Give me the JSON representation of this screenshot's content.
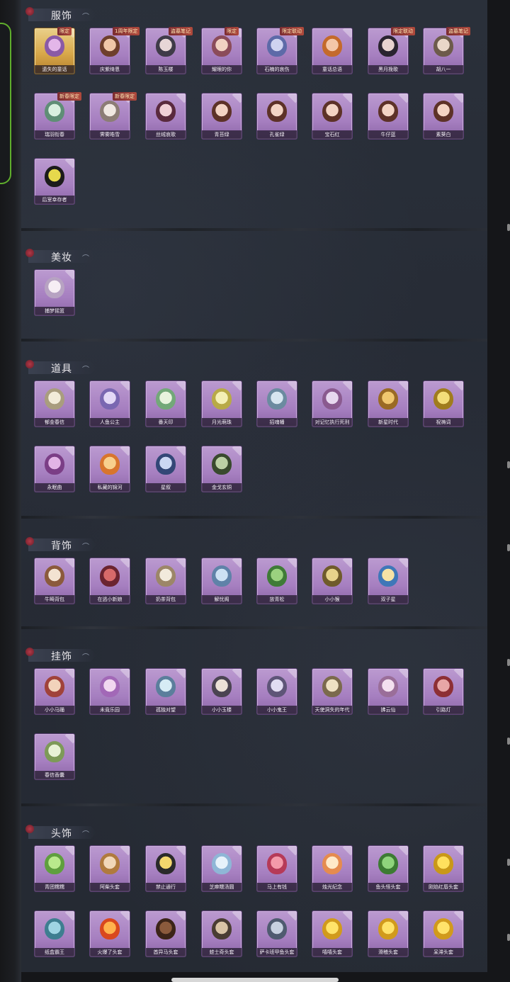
{
  "sections": [
    {
      "title": "服饰",
      "items": [
        {
          "label": "遗失的童话",
          "badge": "限定",
          "icon": "costume-icon",
          "c1": "#e3b6e9",
          "c2": "#8a5aa6",
          "card": "gold"
        },
        {
          "label": "庆紫绮恩",
          "badge": "1周年限定",
          "icon": "costume-icon",
          "c1": "#f0c7a8",
          "c2": "#6e3f2c"
        },
        {
          "label": "陈玉楼",
          "badge": "盗墓笔记",
          "icon": "costume-icon",
          "c1": "#e7d6d6",
          "c2": "#3f3b48"
        },
        {
          "label": "耀眼的你",
          "badge": "限定",
          "icon": "costume-icon",
          "c1": "#f1d2c2",
          "c2": "#8b4c5a"
        },
        {
          "label": "石楠的哀伤",
          "badge": "限定联动",
          "icon": "costume-icon",
          "c1": "#cfd3f0",
          "c2": "#5d6aa8"
        },
        {
          "label": "童话总语",
          "badge": "",
          "icon": "costume-icon",
          "c1": "#f4c7a8",
          "c2": "#c46a2b"
        },
        {
          "label": "黑月挽歌",
          "badge": "限定联动",
          "icon": "costume-icon",
          "c1": "#e7d2cf",
          "c2": "#2a2430"
        },
        {
          "label": "胡八一",
          "badge": "盗墓笔记",
          "icon": "costume-icon",
          "c1": "#e9d7c8",
          "c2": "#6d5b4b"
        },
        {
          "label": "瑞羽衔春",
          "badge": "新春限定",
          "icon": "costume-icon",
          "c1": "#d9f0e0",
          "c2": "#5f8e76"
        },
        {
          "label": "霁雾皓雪",
          "badge": "新春限定",
          "icon": "costume-icon",
          "c1": "#f0e8e2",
          "c2": "#8c7d76"
        },
        {
          "label": "丝绒哀歌",
          "badge": "",
          "icon": "costume-icon",
          "c1": "#f0cfd6",
          "c2": "#5a2a3e"
        },
        {
          "label": "青苔绿",
          "badge": "",
          "icon": "costume-icon",
          "c1": "#f3d4c4",
          "c2": "#5d3228"
        },
        {
          "label": "孔雀绿",
          "badge": "",
          "icon": "costume-icon",
          "c1": "#f3d4c4",
          "c2": "#5d3228"
        },
        {
          "label": "宝石红",
          "badge": "",
          "icon": "costume-icon",
          "c1": "#f3d4c4",
          "c2": "#5d3228"
        },
        {
          "label": "牛仔蓝",
          "badge": "",
          "icon": "costume-icon",
          "c1": "#f3d4c4",
          "c2": "#5d3228"
        },
        {
          "label": "素葵白",
          "badge": "",
          "icon": "costume-icon",
          "c1": "#f3d4c4",
          "c2": "#5d3228"
        },
        {
          "label": "后室幸存者",
          "badge": "",
          "icon": "costume-icon",
          "c1": "#e6d94c",
          "c2": "#1b1b1b",
          "card": "dark"
        }
      ]
    },
    {
      "title": "美妆",
      "items": [
        {
          "label": "捕梦摇篮",
          "badge": "",
          "icon": "makeup-icon",
          "c1": "#f6eef4",
          "c2": "#b7a3c2"
        }
      ]
    },
    {
      "title": "道具",
      "items": [
        {
          "label": "郁金春信",
          "badge": "",
          "icon": "prop-icon",
          "c1": "#f2ecd9",
          "c2": "#a99d7e"
        },
        {
          "label": "人鱼公主",
          "badge": "",
          "icon": "prop-icon",
          "c1": "#e3d8f6",
          "c2": "#7a67b1"
        },
        {
          "label": "番天印",
          "badge": "",
          "icon": "prop-icon",
          "c1": "#e8f3de",
          "c2": "#73a879"
        },
        {
          "label": "月光萌珠",
          "badge": "",
          "icon": "prop-icon",
          "c1": "#f4f0b5",
          "c2": "#b8aa46"
        },
        {
          "label": "招魂幡",
          "badge": "",
          "icon": "prop-icon",
          "c1": "#d6e6f0",
          "c2": "#6b8ba0"
        },
        {
          "label": "对记忆执行死刑",
          "badge": "",
          "icon": "prop-icon",
          "c1": "#e7d8ef",
          "c2": "#8a5a8f"
        },
        {
          "label": "新星时代",
          "badge": "",
          "icon": "prop-icon",
          "c1": "#f0c76f",
          "c2": "#9a6a24"
        },
        {
          "label": "祝祷词",
          "badge": "",
          "icon": "prop-icon",
          "c1": "#f3dd79",
          "c2": "#a07c1d"
        },
        {
          "label": "永眠曲",
          "badge": "",
          "icon": "prop-icon",
          "c1": "#e2b4e6",
          "c2": "#7b3e86"
        },
        {
          "label": "私藏的锦河",
          "badge": "",
          "icon": "prop-icon",
          "c1": "#f8d08d",
          "c2": "#d8752d"
        },
        {
          "label": "星叙",
          "badge": "",
          "icon": "prop-icon",
          "c1": "#cbd7f3",
          "c2": "#334777"
        },
        {
          "label": "金戈玄铜",
          "badge": "",
          "icon": "prop-icon",
          "c1": "#bcd1a5",
          "c2": "#394a2e"
        }
      ]
    },
    {
      "title": "背饰",
      "items": [
        {
          "label": "牛畸背包",
          "badge": "",
          "icon": "backpack-icon",
          "c1": "#f3e3d2",
          "c2": "#8b5a3c"
        },
        {
          "label": "在逃小新娘",
          "badge": "",
          "icon": "backpack-icon",
          "c1": "#d76a6a",
          "c2": "#6b2430"
        },
        {
          "label": "奶茶背包",
          "badge": "",
          "icon": "backpack-icon",
          "c1": "#f2eadc",
          "c2": "#9c8668"
        },
        {
          "label": "解忧阁",
          "badge": "",
          "icon": "backpack-icon",
          "c1": "#cce1f3",
          "c2": "#5f82a8"
        },
        {
          "label": "放青松",
          "badge": "",
          "icon": "backpack-icon",
          "c1": "#9bd27f",
          "c2": "#3f7b36"
        },
        {
          "label": "小小猴",
          "badge": "",
          "icon": "backpack-icon",
          "c1": "#e7d38b",
          "c2": "#6f5b2b"
        },
        {
          "label": "双子星",
          "badge": "",
          "icon": "backpack-icon",
          "c1": "#f6e2a5",
          "c2": "#3f77b8"
        }
      ]
    },
    {
      "title": "挂饰",
      "items": [
        {
          "label": "小小马踊",
          "badge": "",
          "icon": "pendant-icon",
          "c1": "#f2d3bb",
          "c2": "#a0423a"
        },
        {
          "label": "未竟乐园",
          "badge": "",
          "icon": "pendant-icon",
          "c1": "#f1d7f0",
          "c2": "#a268b7"
        },
        {
          "label": "孤独对望",
          "badge": "",
          "icon": "pendant-icon",
          "c1": "#d6ecf5",
          "c2": "#5b7e9c"
        },
        {
          "label": "小小玉楼",
          "badge": "",
          "icon": "pendant-icon",
          "c1": "#ebe1d7",
          "c2": "#4b4452"
        },
        {
          "label": "小小鬼王",
          "badge": "",
          "icon": "pendant-icon",
          "c1": "#e1dcf2",
          "c2": "#5e5578"
        },
        {
          "label": "天使洞失的年代",
          "badge": "",
          "icon": "pendant-icon",
          "c1": "#efe2c3",
          "c2": "#7b6a4d"
        },
        {
          "label": "拂云仙",
          "badge": "",
          "icon": "pendant-icon",
          "c1": "#f3e0ef",
          "c2": "#9a6e99"
        },
        {
          "label": "引路灯",
          "badge": "",
          "icon": "pendant-icon",
          "c1": "#e7a6a6",
          "c2": "#8d2f34"
        },
        {
          "label": "春信香囊",
          "badge": "",
          "icon": "pendant-icon",
          "c1": "#e8f2d6",
          "c2": "#7d9a58"
        }
      ]
    },
    {
      "title": "头饰",
      "items": [
        {
          "label": "青团糯糯",
          "badge": "",
          "icon": "headwear-icon",
          "c1": "#b9ea8c",
          "c2": "#5f9f3e"
        },
        {
          "label": "阿柴头套",
          "badge": "",
          "icon": "headwear-icon",
          "c1": "#f1d7b8",
          "c2": "#b07a3e"
        },
        {
          "label": "禁止通行",
          "badge": "",
          "icon": "headwear-icon",
          "c1": "#f3d76d",
          "c2": "#2a2a2a"
        },
        {
          "label": "芝麻糯汤圆",
          "badge": "",
          "icon": "headwear-icon",
          "c1": "#e7f2fa",
          "c2": "#8fb6d6"
        },
        {
          "label": "马上有钱",
          "badge": "",
          "icon": "headwear-icon",
          "c1": "#f49aaa",
          "c2": "#b63a58"
        },
        {
          "label": "烛光纪念",
          "badge": "",
          "icon": "headwear-icon",
          "c1": "#ffe9c8",
          "c2": "#e58b4f"
        },
        {
          "label": "鱼头怪头套",
          "badge": "",
          "icon": "headwear-icon",
          "c1": "#8fd47c",
          "c2": "#3c7b33"
        },
        {
          "label": "刚焰红唇头套",
          "badge": "",
          "icon": "headwear-icon",
          "c1": "#ffe05e",
          "c2": "#c99818"
        },
        {
          "label": "纸盒霸王",
          "badge": "",
          "icon": "headwear-icon",
          "c1": "#9fd5e3",
          "c2": "#3e7e90"
        },
        {
          "label": "火爆了头套",
          "badge": "",
          "icon": "headwear-icon",
          "c1": "#ffb24d",
          "c2": "#d9481d"
        },
        {
          "label": "酋异马头套",
          "badge": "",
          "icon": "headwear-icon",
          "c1": "#8b5a3c",
          "c2": "#3c2418"
        },
        {
          "label": "蛙士奇头套",
          "badge": "",
          "icon": "headwear-icon",
          "c1": "#d9c4a6",
          "c2": "#4a3d33"
        },
        {
          "label": "萨卡班甲鱼头套",
          "badge": "",
          "icon": "headwear-icon",
          "c1": "#c7d1e0",
          "c2": "#4f5b70"
        },
        {
          "label": "嘻嘻头套",
          "badge": "",
          "icon": "headwear-icon",
          "c1": "#ffe36a",
          "c2": "#d19a1c"
        },
        {
          "label": "滑稽头套",
          "badge": "",
          "icon": "headwear-icon",
          "c1": "#ffe36a",
          "c2": "#d19a1c"
        },
        {
          "label": "呆滞头套",
          "badge": "",
          "icon": "headwear-icon",
          "c1": "#ffe36a",
          "c2": "#d19a1c"
        }
      ]
    }
  ]
}
